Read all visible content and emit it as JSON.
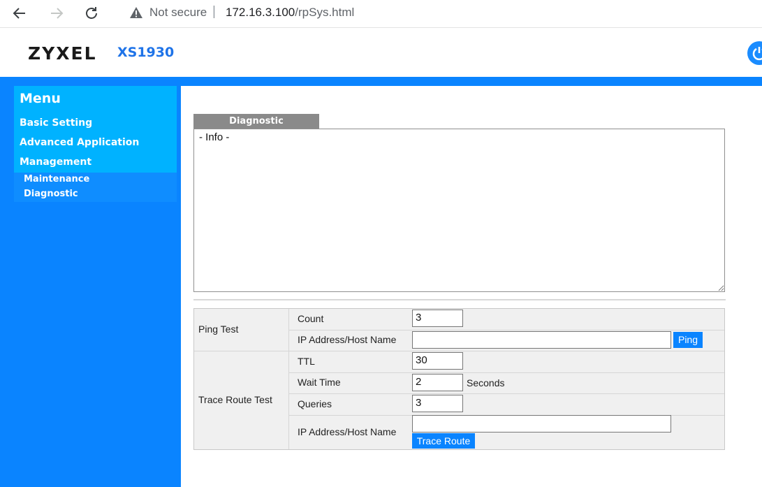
{
  "browser": {
    "security_label": "Not secure",
    "separator": "|",
    "url_host": "172.16.3.100",
    "url_path": "/rpSys.html"
  },
  "header": {
    "brand": "ZYXEL",
    "model": "XS1930"
  },
  "menu": {
    "title": "Menu",
    "items": [
      {
        "label": "Basic Setting"
      },
      {
        "label": "Advanced Application"
      },
      {
        "label": "Management"
      }
    ],
    "sub_items": [
      {
        "label": "Maintenance"
      },
      {
        "label": "Diagnostic"
      }
    ]
  },
  "diagnostic": {
    "tab_label": "Diagnostic",
    "info_text": "- Info -",
    "ping": {
      "section_label": "Ping Test",
      "count_label": "Count",
      "count_value": "3",
      "host_label": "IP Address/Host Name",
      "host_value": "",
      "button_label": "Ping"
    },
    "trace": {
      "section_label": "Trace Route Test",
      "ttl_label": "TTL",
      "ttl_value": "30",
      "wait_label": "Wait Time",
      "wait_value": "2",
      "wait_unit": "Seconds",
      "queries_label": "Queries",
      "queries_value": "3",
      "host_label": "IP Address/Host Name",
      "host_value": "",
      "button_label": "Trace Route"
    }
  },
  "colors": {
    "accent": "#0a84ff",
    "menu_bg": "#00b2ff"
  }
}
